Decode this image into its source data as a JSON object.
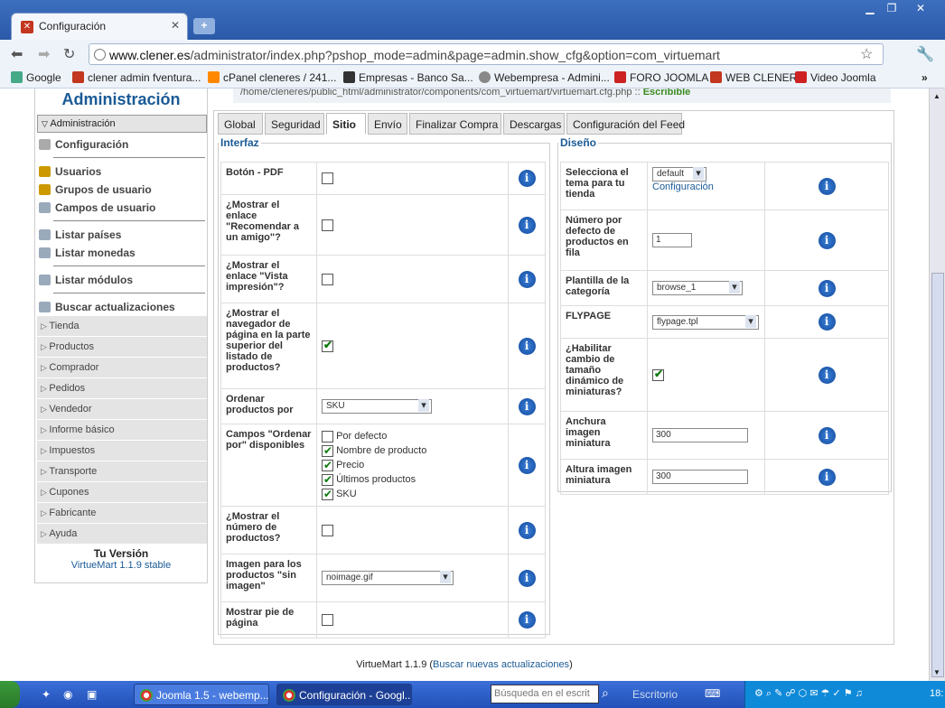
{
  "browser": {
    "tab_title": "Configuración",
    "url_host": "www.clener.es",
    "url_path": "/administrator/index.php?pshop_mode=admin&page=admin.show_cfg&option=com_virtuemart",
    "bookmarks": [
      "Google",
      "clener admin fventura...",
      "cPanel cleneres / 241...",
      "Empresas - Banco Sa...",
      "Webempresa - Admini...",
      "FORO JOOMLA",
      "WEB CLENER",
      "Video Joomla"
    ]
  },
  "path_line": {
    "text": "/home/cleneres/public_html/administrator/components/com_virtuemart/virtuemart.cfg.php ::",
    "status": "Escribible"
  },
  "sidebar": {
    "title": "Administración",
    "active": "Administración",
    "config": "Configuración",
    "users": [
      "Usuarios",
      "Grupos de usuario",
      "Campos de usuario"
    ],
    "lists": [
      "Listar países",
      "Listar monedas"
    ],
    "modules": "Listar módulos",
    "updates": "Buscar actualizaciones",
    "groups": [
      "Tienda",
      "Productos",
      "Comprador",
      "Pedidos",
      "Vendedor",
      "Informe básico",
      "Impuestos",
      "Transporte",
      "Cupones",
      "Fabricante",
      "Ayuda"
    ],
    "version_label": "Tu Versión",
    "version": "VirtueMart 1.1.9 stable"
  },
  "tabs": [
    "Global",
    "Seguridad",
    "Sitio",
    "Envío",
    "Finalizar Compra",
    "Descargas",
    "Configuración del Feed"
  ],
  "interfaz": {
    "legend": "Interfaz",
    "rows": {
      "pdf": "Botón - PDF",
      "recommend": "¿Mostrar el enlace \"Recomendar a un amigo\"?",
      "print": "¿Mostrar el enlace \"Vista impresión\"?",
      "navigator": "¿Mostrar el navegador de página en la parte superior del listado de productos?",
      "order": "Ordenar productos por",
      "order_value": "SKU",
      "fields": "Campos \"Ordenar por\" disponibles",
      "field_options": [
        "Por defecto",
        "Nombre de producto",
        "Precio",
        "Últimos productos",
        "SKU"
      ],
      "count": "¿Mostrar el número de productos?",
      "noimage": "Imagen para los productos \"sin imagen\"",
      "noimage_value": "noimage.gif",
      "footer": "Mostrar pie de página"
    }
  },
  "diseno": {
    "legend": "Diseño",
    "rows": {
      "theme": "Selecciona el tema para tu tienda",
      "theme_value": "default",
      "theme_link": "Configuración",
      "per_row": "Número por defecto de productos en fila",
      "per_row_value": "1",
      "category": "Plantilla de la categoría",
      "category_value": "browse_1",
      "flypage": "FLYPAGE",
      "flypage_value": "flypage.tpl",
      "dynamic": "¿Habilitar cambio de tamaño dinámico de miniaturas?",
      "width": "Anchura imagen miniatura",
      "width_value": "300",
      "height": "Altura imagen miniatura",
      "height_value": "300"
    }
  },
  "footer": {
    "version": "VirtueMart 1.1.9 (",
    "link": "Buscar nuevas actualizaciones",
    "close": ")"
  },
  "taskbar": {
    "task1": "Joomla 1.5 - webemp...",
    "task2": "Configuración - Googl...",
    "search": "Búsqueda en el escrit",
    "desktop": "Escritorio",
    "clock": "18:"
  }
}
